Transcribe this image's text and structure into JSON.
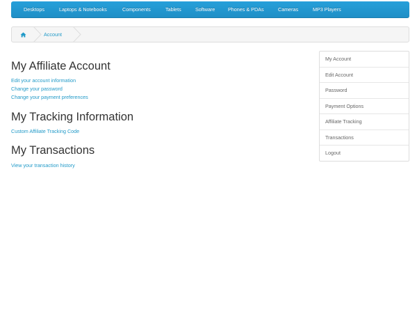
{
  "topnav": {
    "items": [
      {
        "label": "Desktops"
      },
      {
        "label": "Laptops & Notebooks"
      },
      {
        "label": "Components"
      },
      {
        "label": "Tablets"
      },
      {
        "label": "Software"
      },
      {
        "label": "Phones & PDAs"
      },
      {
        "label": "Cameras"
      },
      {
        "label": "MP3 Players"
      }
    ]
  },
  "breadcrumb": {
    "home_icon": "home-icon",
    "account_label": "Account"
  },
  "main": {
    "affiliate": {
      "title": "My Affiliate Account",
      "links": [
        "Edit your account information",
        "Change your password",
        "Change your payment preferences"
      ]
    },
    "tracking": {
      "title": "My Tracking Information",
      "links": [
        "Custom Affiliate Tracking Code"
      ]
    },
    "transactions": {
      "title": "My Transactions",
      "links": [
        "View your transaction history"
      ]
    }
  },
  "sidebar": {
    "items": [
      {
        "label": "My Account"
      },
      {
        "label": "Edit Account"
      },
      {
        "label": "Password"
      },
      {
        "label": "Payment Options"
      },
      {
        "label": "Affiliate Tracking"
      },
      {
        "label": "Transactions"
      },
      {
        "label": "Logout"
      }
    ]
  },
  "colors": {
    "nav_bg": "#229ac8",
    "link": "#229ac8",
    "heading": "#333333"
  }
}
